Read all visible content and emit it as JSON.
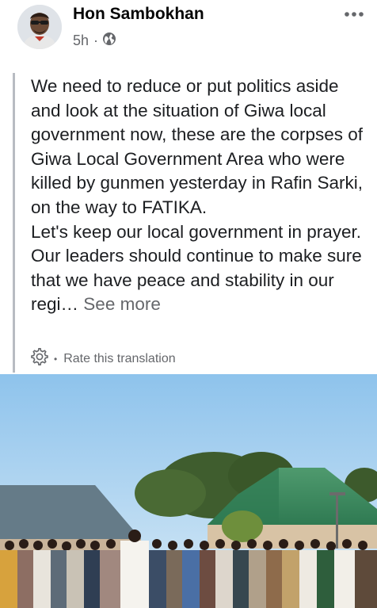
{
  "post": {
    "author": "Hon Sambokhan",
    "time": "5h",
    "separator": "·",
    "body_text": "We need to reduce or put politics aside and look at the situation of Giwa local government now, these are the corpses of Giwa Local Government Area who were killed by gunmen yesterday in Rafin Sarki, on the way to FATIKA.\nLet's keep our local government in prayer. Our leaders should continue to make sure that we have peace and stability in our regi…",
    "see_more": "See more",
    "translation_dot": "•",
    "rate_translation": "Rate this translation"
  },
  "icons": {
    "audience": "globe-icon",
    "options": "more-horizontal-icon",
    "settings": "gear-icon"
  },
  "colors": {
    "text": "#1c1e21",
    "secondary": "#65676b",
    "quote_bar": "#b8bcc2"
  }
}
